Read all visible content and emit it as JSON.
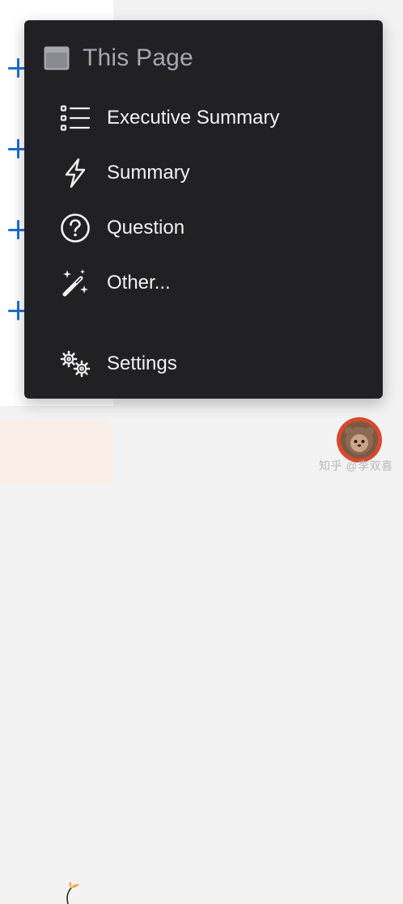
{
  "menu": {
    "header": {
      "title": "This Page",
      "icon": "browser-window-icon"
    },
    "items": [
      {
        "label": "Executive Summary",
        "icon": "list-icon"
      },
      {
        "label": "Summary",
        "icon": "lightning-icon"
      },
      {
        "label": "Question",
        "icon": "question-circle-icon"
      },
      {
        "label": "Other...",
        "icon": "magic-wand-icon"
      }
    ],
    "settings": {
      "label": "Settings",
      "icon": "gears-icon"
    }
  },
  "watermark": "知乎 @李双喜",
  "colors": {
    "menu_bg": "#212125",
    "accent": "#1e6fd0",
    "avatar_ring": "#d84a2c"
  }
}
